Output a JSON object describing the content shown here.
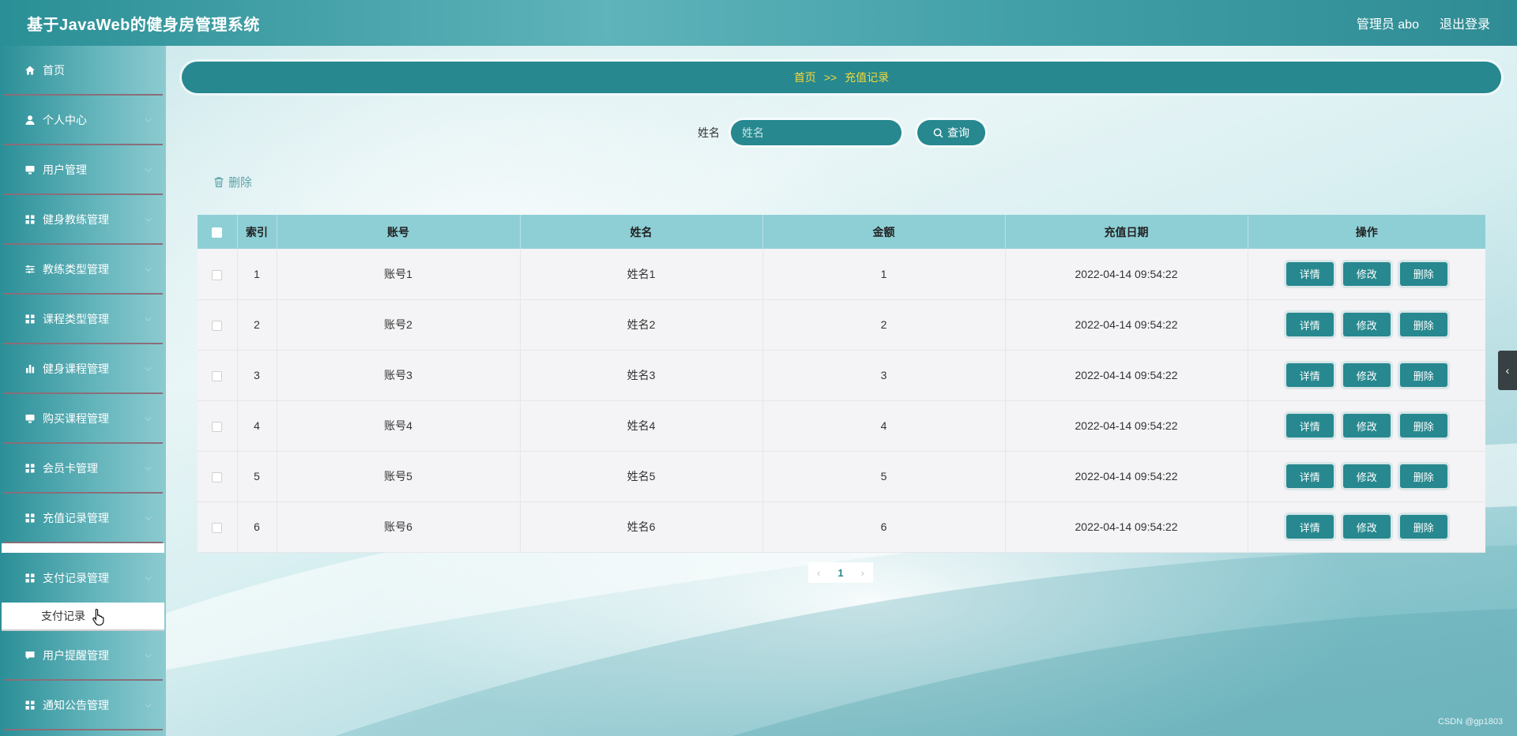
{
  "header": {
    "title": "基于JavaWeb的健身房管理系统",
    "user": "管理员 abo",
    "logout": "退出登录"
  },
  "sidebar": {
    "items": [
      {
        "label": "首页",
        "icon": "home-icon"
      },
      {
        "label": "个人中心",
        "icon": "person-icon"
      },
      {
        "label": "用户管理",
        "icon": "monitor-icon"
      },
      {
        "label": "健身教练管理",
        "icon": "grid-icon"
      },
      {
        "label": "教练类型管理",
        "icon": "sliders-icon"
      },
      {
        "label": "课程类型管理",
        "icon": "grid-icon"
      },
      {
        "label": "健身课程管理",
        "icon": "bar-chart-icon"
      },
      {
        "label": "购买课程管理",
        "icon": "monitor-icon"
      },
      {
        "label": "会员卡管理",
        "icon": "grid-icon"
      },
      {
        "label": "充值记录管理",
        "icon": "grid-icon"
      },
      {
        "label": "支付记录管理",
        "icon": "grid-icon"
      },
      {
        "label": "用户提醒管理",
        "icon": "chat-icon"
      },
      {
        "label": "通知公告管理",
        "icon": "grid-icon"
      }
    ],
    "submenu": {
      "label": "支付记录"
    }
  },
  "breadcrumb": {
    "home": "首页",
    "separator": ">>",
    "current": "充值记录"
  },
  "search": {
    "label": "姓名",
    "placeholder": "姓名",
    "button": "查询"
  },
  "toolbar": {
    "delete": "删除"
  },
  "table": {
    "headers": [
      "索引",
      "账号",
      "姓名",
      "金额",
      "充值日期",
      "操作"
    ],
    "rows": [
      {
        "index": "1",
        "account": "账号1",
        "name": "姓名1",
        "amount": "1",
        "date": "2022-04-14 09:54:22"
      },
      {
        "index": "2",
        "account": "账号2",
        "name": "姓名2",
        "amount": "2",
        "date": "2022-04-14 09:54:22"
      },
      {
        "index": "3",
        "account": "账号3",
        "name": "姓名3",
        "amount": "3",
        "date": "2022-04-14 09:54:22"
      },
      {
        "index": "4",
        "account": "账号4",
        "name": "姓名4",
        "amount": "4",
        "date": "2022-04-14 09:54:22"
      },
      {
        "index": "5",
        "account": "账号5",
        "name": "姓名5",
        "amount": "5",
        "date": "2022-04-14 09:54:22"
      },
      {
        "index": "6",
        "account": "账号6",
        "name": "姓名6",
        "amount": "6",
        "date": "2022-04-14 09:54:22"
      }
    ],
    "actions": {
      "detail": "详情",
      "edit": "修改",
      "delete": "删除"
    }
  },
  "pagination": {
    "prev": "‹",
    "current": "1",
    "next": "›"
  },
  "watermark": "CSDN @gp1803",
  "colors": {
    "accent": "#27888f",
    "breadcrumb_text": "#f5d83a",
    "table_header": "#8ecfd6"
  }
}
